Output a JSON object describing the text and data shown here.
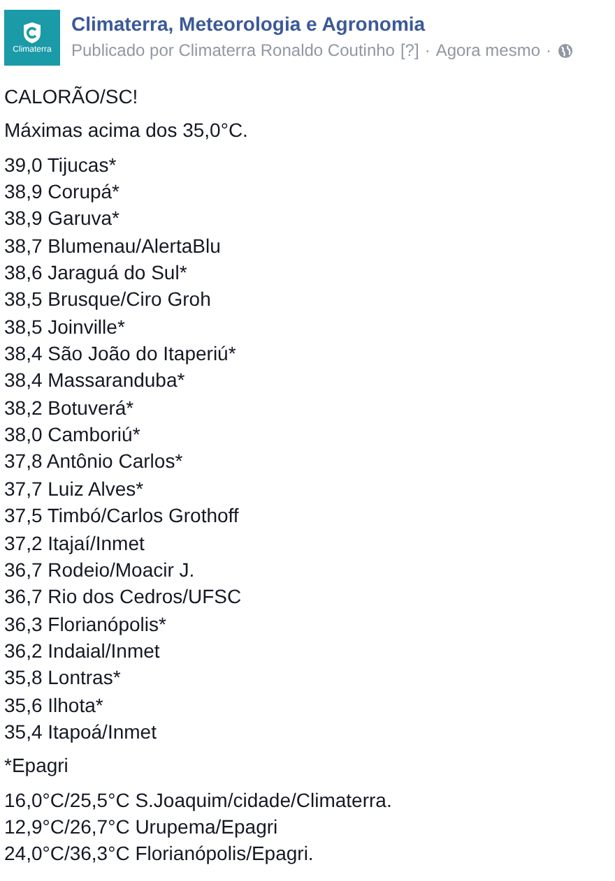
{
  "post": {
    "logo_text": "Climaterra",
    "page_name": "Climaterra, Meteorologia e Agronomia",
    "published_by": "Publicado por Climaterra Ronaldo Coutinho",
    "help_mark": "[?]",
    "time": "Agora mesmo",
    "separator": "·"
  },
  "headline": "CALORÃO/SC!",
  "intro": "Máximas acima dos 35,0°C.",
  "readings": [
    "39,0 Tijucas*",
    "38,9 Corupá*",
    "38,9 Garuva*",
    "38,7 Blumenau/AlertaBlu",
    "38,6 Jaraguá do Sul*",
    "38,5 Brusque/Ciro Groh",
    "38,5 Joinville*",
    "38,4 São João do Itaperiú*",
    "38,4 Massaranduba*",
    "38,2 Botuverá*",
    "38,0 Camboriú*",
    "37,8 Antônio Carlos*",
    "37,7 Luiz Alves*",
    "37,5 Timbó/Carlos Grothoff",
    "37,2 Itajaí/Inmet",
    "36,7 Rodeio/Moacir J.",
    "36,7 Rio dos Cedros/UFSC",
    "36,3 Florianópolis*",
    "36,2 Indaial/Inmet",
    "35,8 Lontras*",
    "35,6 Ilhota*",
    "35,4 Itapoá/Inmet"
  ],
  "footnote": "*Epagri",
  "ranges": [
    "16,0°C/25,5°C S.Joaquim/cidade/Climaterra.",
    "12,9°C/26,7°C Urupema/Epagri",
    "24,0°C/36,3°C Florianópolis/Epagri."
  ]
}
